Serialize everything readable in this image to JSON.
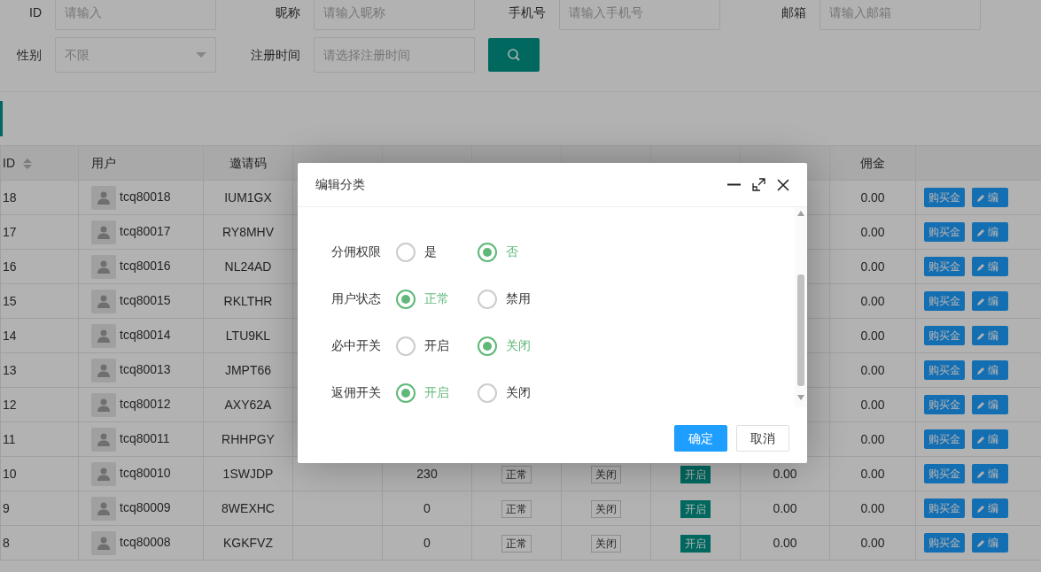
{
  "filters": [
    {
      "label": "ID",
      "placeholder": "请输入",
      "kind": "input"
    },
    {
      "label": "昵称",
      "placeholder": "请输入昵称",
      "kind": "input"
    },
    {
      "label": "手机号",
      "placeholder": "请输入手机号",
      "kind": "input"
    },
    {
      "label": "邮箱",
      "placeholder": "请输入邮箱",
      "kind": "input"
    },
    {
      "label": "性别",
      "value": "不限",
      "kind": "select"
    },
    {
      "label": "注册时间",
      "placeholder": "请选择注册时间",
      "kind": "input"
    },
    {
      "kind": "search"
    }
  ],
  "table": {
    "columns": [
      {
        "label": "ID",
        "sortable": true
      },
      {
        "label": "用户",
        "sortable": false
      },
      {
        "label": "邀请码",
        "sortable": false
      },
      {
        "label": "佣金",
        "sortable": false
      }
    ],
    "rows": [
      {
        "id": "18",
        "user": "tcq80018",
        "invite_code": "IUM1GX",
        "commission": "0.00",
        "actions": [
          "购买金",
          "编"
        ]
      },
      {
        "id": "17",
        "user": "tcq80017",
        "invite_code": "RY8MHV",
        "commission": "0.00",
        "actions": [
          "购买金",
          "编"
        ]
      },
      {
        "id": "16",
        "user": "tcq80016",
        "invite_code": "NL24AD",
        "commission": "0.00",
        "actions": [
          "购买金",
          "编"
        ]
      },
      {
        "id": "15",
        "user": "tcq80015",
        "invite_code": "RKLTHR",
        "commission": "0.00",
        "actions": [
          "购买金",
          "编"
        ]
      },
      {
        "id": "14",
        "user": "tcq80014",
        "invite_code": "LTU9KL",
        "commission": "0.00",
        "actions": [
          "购买金",
          "编"
        ]
      },
      {
        "id": "13",
        "user": "tcq80013",
        "invite_code": "JMPT66",
        "commission": "0.00",
        "actions": [
          "购买金",
          "编"
        ]
      },
      {
        "id": "12",
        "user": "tcq80012",
        "invite_code": "AXY62A",
        "commission": "0.00",
        "actions": [
          "购买金",
          "编"
        ]
      },
      {
        "id": "11",
        "user": "tcq80011",
        "invite_code": "RHHPGY",
        "commission": "0.00",
        "actions": [
          "购买金",
          "编"
        ]
      },
      {
        "id": "10",
        "user": "tcq80010",
        "invite_code": "1SWJDP",
        "open_count": "230",
        "status": {
          "text": "正常",
          "on": false
        },
        "must_win": {
          "text": "关闭",
          "on": false
        },
        "rebate": {
          "text": "开启",
          "on": true
        },
        "purchase": "0.00",
        "commission": "0.00",
        "actions": [
          "购买金",
          "编"
        ]
      },
      {
        "id": "9",
        "user": "tcq80009",
        "invite_code": "8WEXHC",
        "open_count": "0",
        "status": {
          "text": "正常",
          "on": false
        },
        "must_win": {
          "text": "关闭",
          "on": false
        },
        "rebate": {
          "text": "开启",
          "on": true
        },
        "purchase": "0.00",
        "commission": "0.00",
        "actions": [
          "购买金",
          "编"
        ]
      },
      {
        "id": "8",
        "user": "tcq80008",
        "invite_code": "KGKFVZ",
        "open_count": "0",
        "status": {
          "text": "正常",
          "on": false
        },
        "must_win": {
          "text": "关闭",
          "on": false
        },
        "rebate": {
          "text": "开启",
          "on": true
        },
        "purchase": "0.00",
        "commission": "0.00",
        "actions": [
          "购买金",
          "编"
        ]
      }
    ]
  },
  "dialog": {
    "title": "编辑分类",
    "fields": [
      {
        "label": "分佣权限",
        "options": [
          {
            "label": "是",
            "selected": false
          },
          {
            "label": "否",
            "selected": true
          }
        ]
      },
      {
        "label": "用户状态",
        "options": [
          {
            "label": "正常",
            "selected": true
          },
          {
            "label": "禁用",
            "selected": false
          }
        ]
      },
      {
        "label": "必中开关",
        "options": [
          {
            "label": "开启",
            "selected": false
          },
          {
            "label": "关闭",
            "selected": true
          }
        ]
      },
      {
        "label": "返佣开关",
        "options": [
          {
            "label": "开启",
            "selected": true
          },
          {
            "label": "关闭",
            "selected": false
          }
        ]
      }
    ],
    "buttons": [
      {
        "label": "确定",
        "kind": "primary"
      },
      {
        "label": "取消",
        "kind": "secondary"
      }
    ]
  }
}
